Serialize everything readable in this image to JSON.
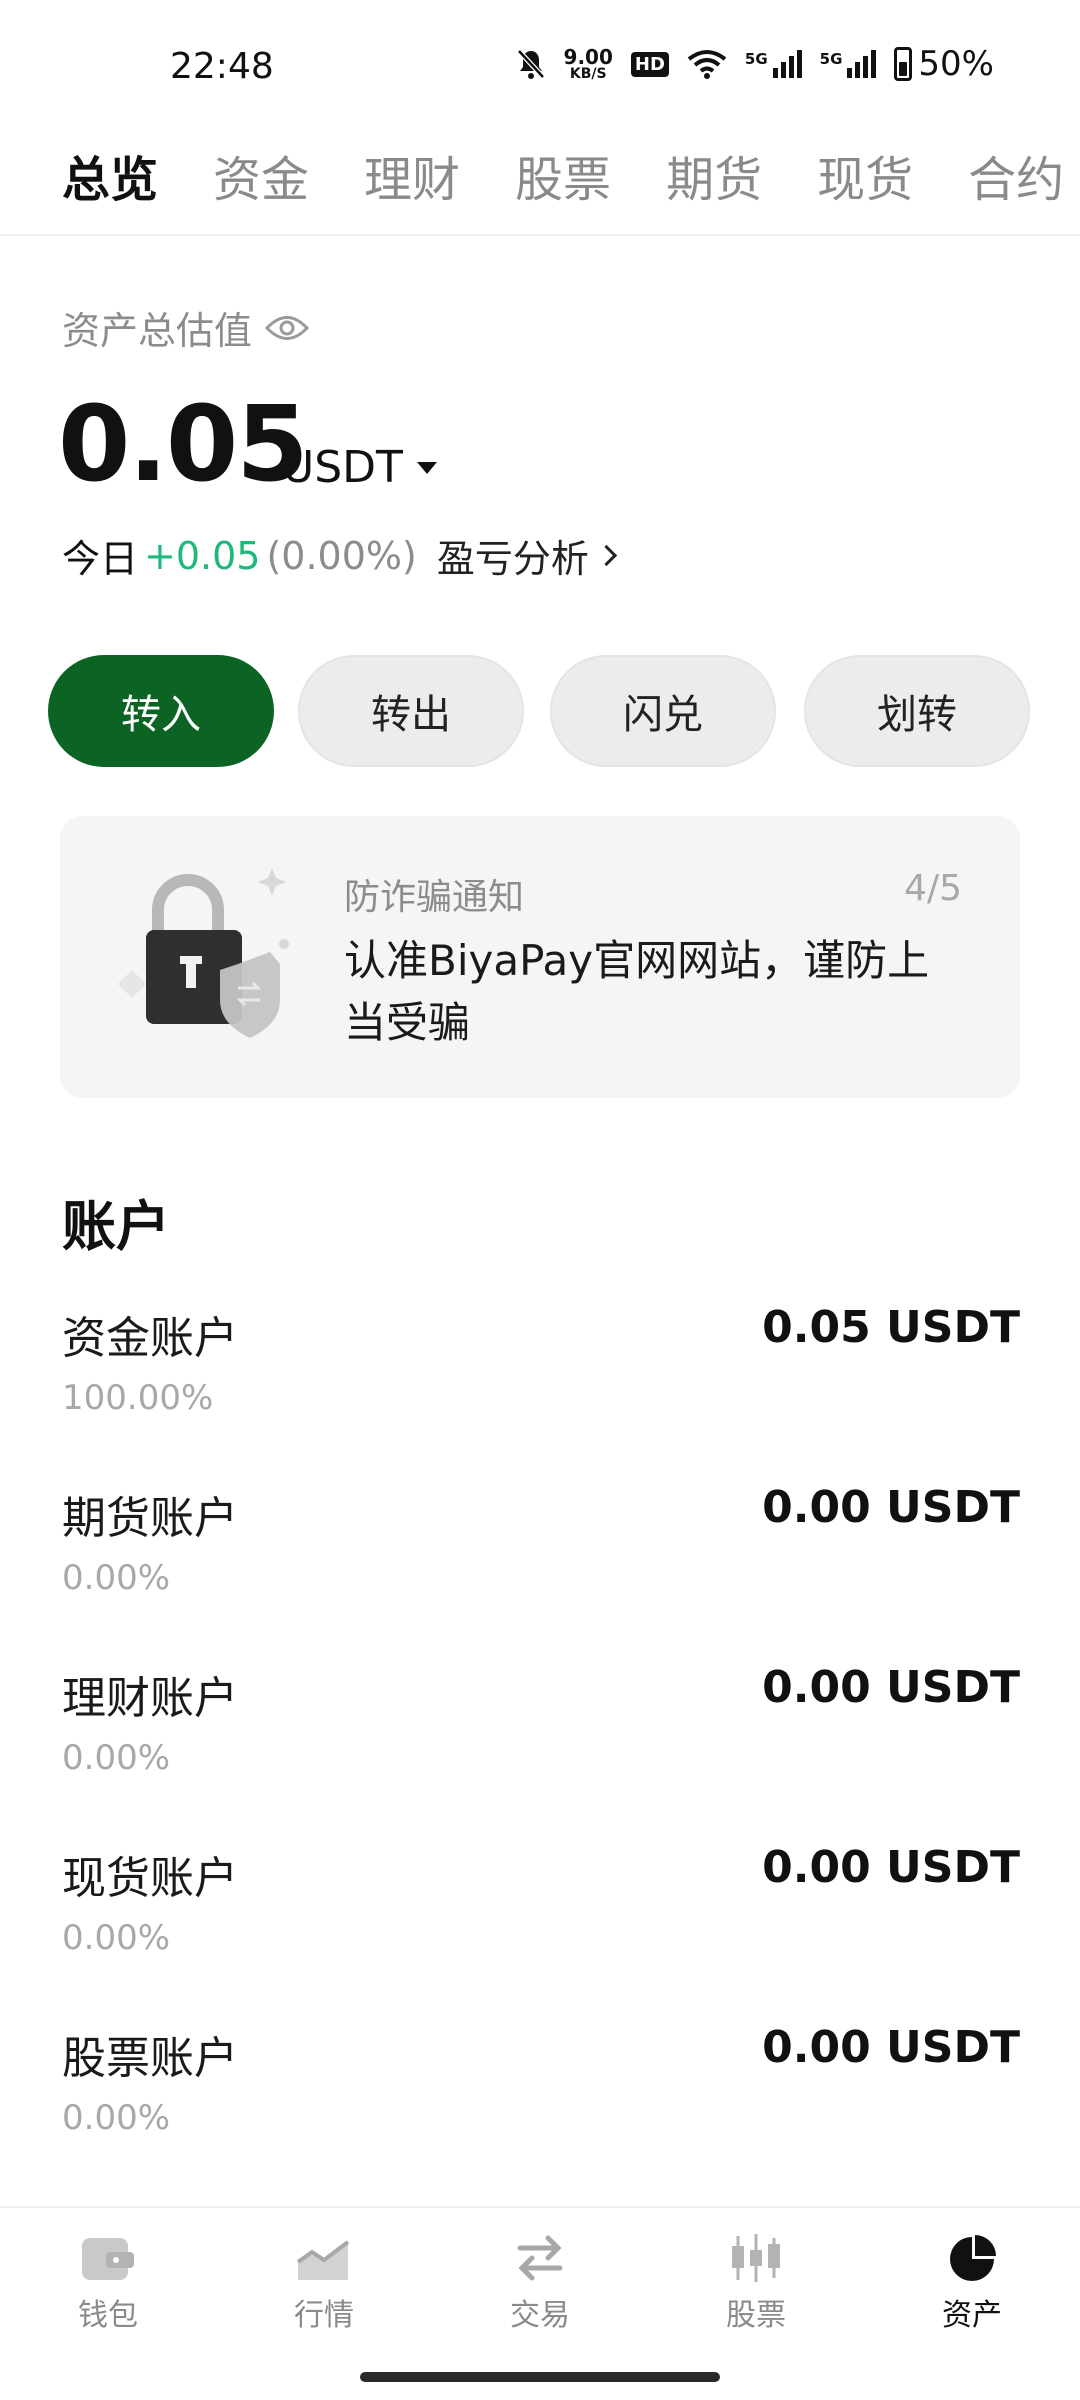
{
  "status_bar": {
    "time": "22:48",
    "net_speed_value": "9.00",
    "net_speed_unit": "KB/S",
    "hd_badge": "HD",
    "sig1_label": "5G",
    "sig2_label": "5G",
    "battery": "50%"
  },
  "tabs": [
    "总览",
    "资金",
    "理财",
    "股票",
    "期货",
    "现货",
    "合约"
  ],
  "summary": {
    "label": "资产总估值",
    "value": "0.05",
    "unit": "USDT",
    "today_label": "今日",
    "today_change": "+0.05",
    "today_pct": "(0.00%)",
    "analysis_label": "盈亏分析"
  },
  "actions": {
    "deposit": "转入",
    "withdraw": "转出",
    "convert": "闪兑",
    "transfer": "划转"
  },
  "notice": {
    "title": "防诈骗通知",
    "page": "4/5",
    "text": "认准BiyaPay官网网站，谨防上当受骗"
  },
  "accounts": {
    "title": "账户",
    "items": [
      {
        "name": "资金账户",
        "pct": "100.00%",
        "value": "0.05 USDT"
      },
      {
        "name": "期货账户",
        "pct": "0.00%",
        "value": "0.00 USDT"
      },
      {
        "name": "理财账户",
        "pct": "0.00%",
        "value": "0.00 USDT"
      },
      {
        "name": "现货账户",
        "pct": "0.00%",
        "value": "0.00 USDT"
      },
      {
        "name": "股票账户",
        "pct": "0.00%",
        "value": "0.00 USDT"
      }
    ]
  },
  "bottom_nav": [
    "钱包",
    "行情",
    "交易",
    "股票",
    "资产"
  ],
  "colors": {
    "primary": "#0b6324",
    "positive": "#1db97a"
  }
}
